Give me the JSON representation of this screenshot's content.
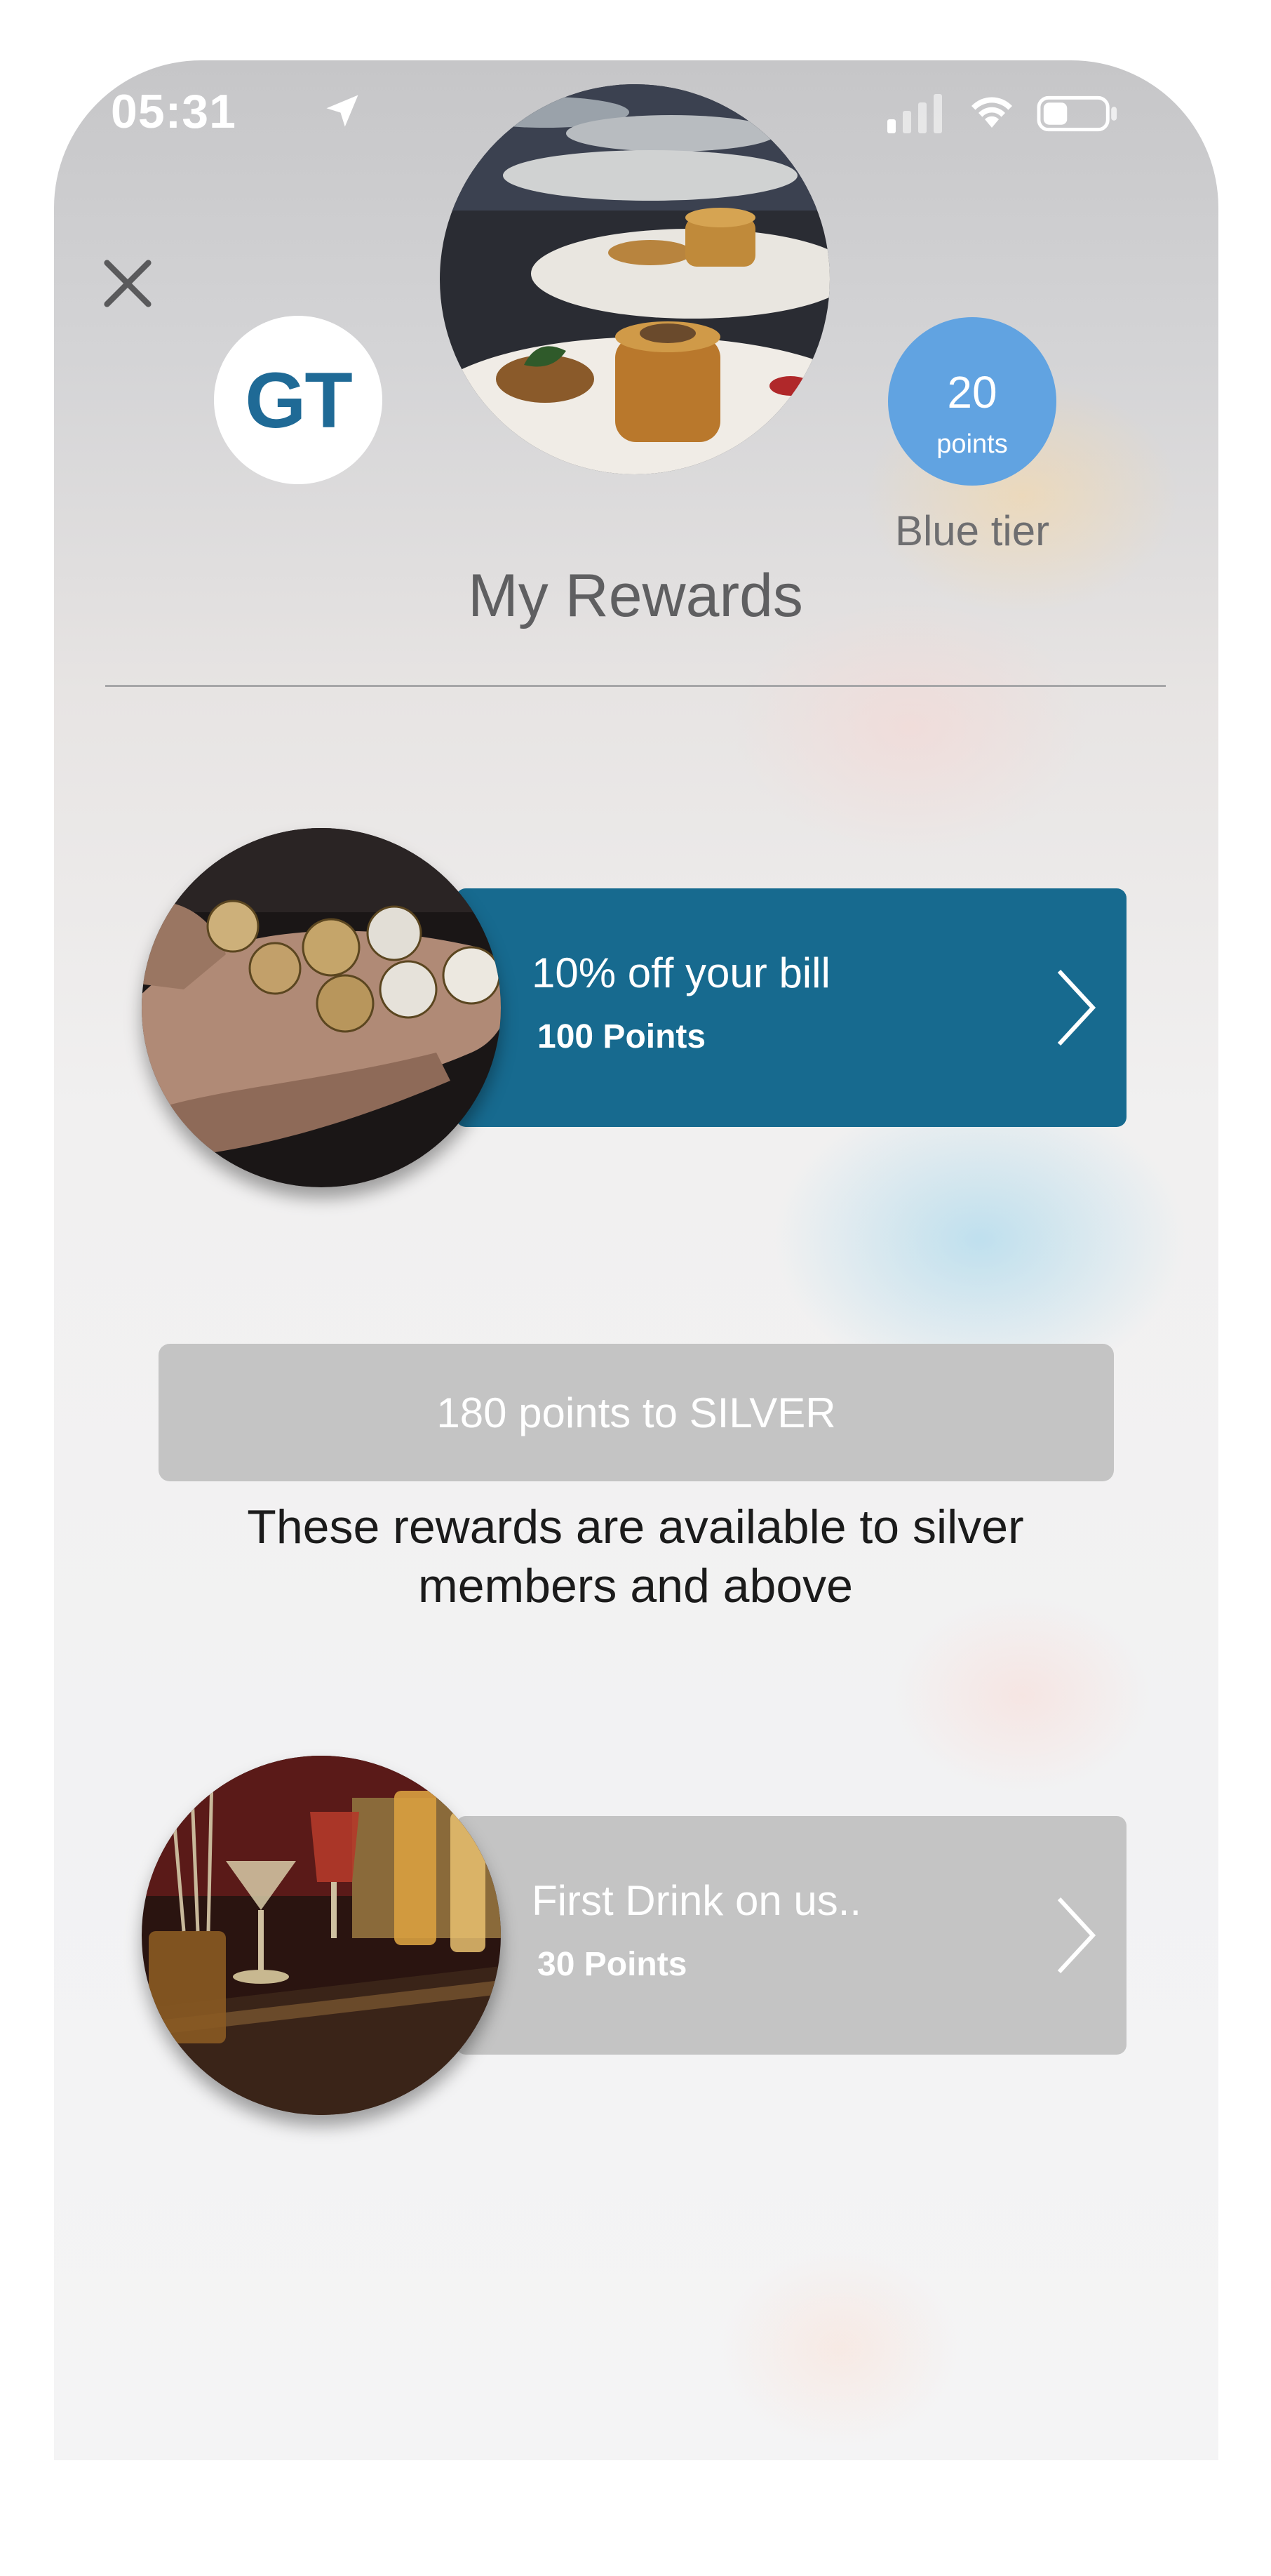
{
  "status_bar": {
    "time": "05:31",
    "icons": [
      "location-arrow-icon",
      "signal-icon",
      "wifi-icon",
      "battery-icon"
    ]
  },
  "header": {
    "close_icon": "close-icon",
    "user_initials": "GT",
    "points_value": "20",
    "points_unit": "points",
    "tier": "Blue tier",
    "title": "My Rewards"
  },
  "rewards": [
    {
      "title": "10% off your bill",
      "points": "100 Points",
      "image": "coins-in-hand",
      "state": "available",
      "color": "#176a8f"
    },
    {
      "title": "First Drink on us..",
      "points": "30 Points",
      "image": "cocktails-at-bar",
      "state": "locked",
      "color": "#c4c4c4"
    }
  ],
  "silver_section": {
    "progress_text": "180 points to SILVER",
    "notice": "These rewards are available to silver members and above"
  },
  "colors": {
    "accent_blue": "#61a3e1",
    "reward_active": "#176a8f",
    "reward_locked": "#c4c4c4",
    "initials": "#1f6a96"
  }
}
